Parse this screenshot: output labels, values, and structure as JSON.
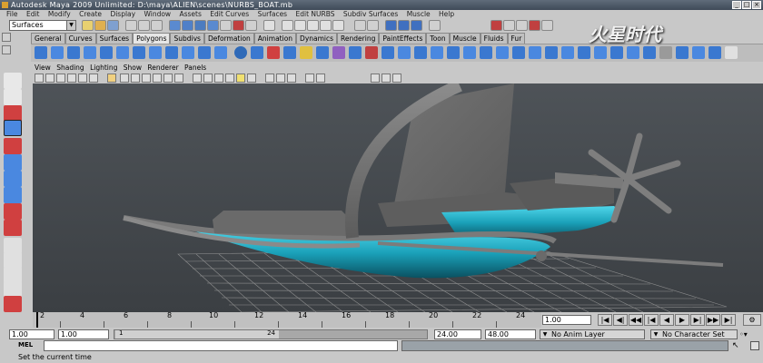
{
  "app": {
    "title": "Autodesk Maya 2009 Unlimited: D:\\maya\\ALIEN\\scenes\\NURBS_BOAT.mb"
  },
  "menubar": [
    "File",
    "Edit",
    "Modify",
    "Create",
    "Display",
    "Window",
    "Assets",
    "Edit Curves",
    "Surfaces",
    "Edit NURBS",
    "Subdiv Surfaces",
    "Muscle",
    "Help"
  ],
  "status_line": {
    "menu_set": "Surfaces"
  },
  "shelf": {
    "tabs": [
      "General",
      "Curves",
      "Surfaces",
      "Polygons",
      "Subdivs",
      "Deformation",
      "Animation",
      "Dynamics",
      "Rendering",
      "PaintEffects",
      "Toon",
      "Muscle",
      "Fluids",
      "Fur"
    ],
    "active_tab": "Polygons"
  },
  "viewport": {
    "menu": [
      "View",
      "Shading",
      "Lighting",
      "Show",
      "Renderer",
      "Panels"
    ]
  },
  "timeline": {
    "ticks": [
      "2",
      "4",
      "6",
      "8",
      "10",
      "12",
      "14",
      "16",
      "18",
      "20",
      "22",
      "24"
    ],
    "current_frame": "1.00"
  },
  "range": {
    "start": "1.00",
    "playback_start": "1.00",
    "slider_label_start": "1",
    "slider_label_end": "24",
    "playback_end": "24.00",
    "end": "48.00",
    "anim_layer": "No Anim Layer",
    "character_set": "No Character Set"
  },
  "command_line": {
    "label": "MEL"
  },
  "help_line": {
    "text": "Set the current time"
  },
  "watermark": {
    "text": "火星时代"
  },
  "colors": {
    "hull_accent": "#1aa0b8",
    "viewport_bg": "#4a4f54",
    "grid": "#9a9a9a"
  }
}
